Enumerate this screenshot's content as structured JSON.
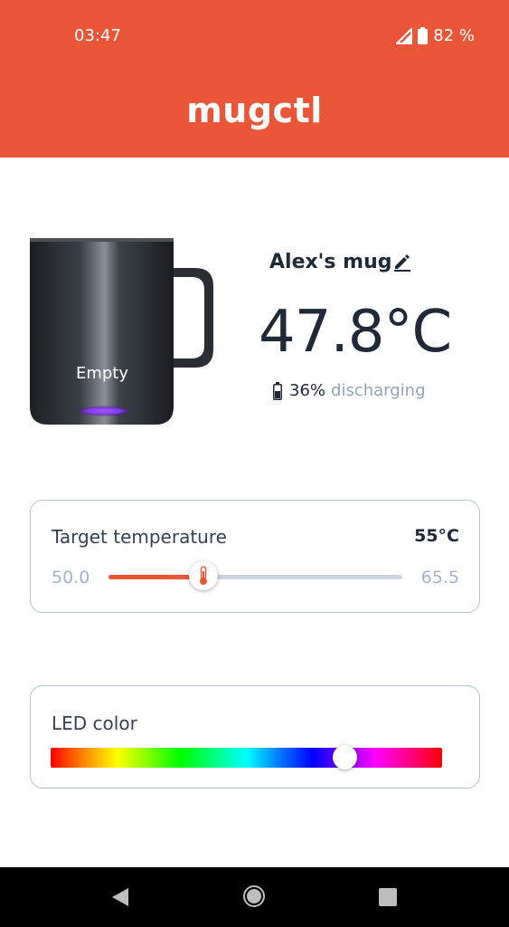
{
  "status_bar": {
    "time": "03:47",
    "battery": "82 %"
  },
  "app_bar": {
    "title": "mugctl"
  },
  "mug": {
    "name": "Alex's mug",
    "liquid_state": "Empty",
    "led_glow_color": "#7c3aed"
  },
  "readout": {
    "temperature": "47.8°C",
    "battery_percent": "36%",
    "battery_state": "discharging"
  },
  "target_temperature": {
    "label": "Target temperature",
    "value_label": "55°C",
    "min_label": "50.0",
    "max_label": "65.5",
    "min": 50.0,
    "max": 65.5,
    "value": 55.0
  },
  "led": {
    "label": "LED color",
    "hue_fraction": 0.75
  },
  "colors": {
    "accent": "#e85637",
    "text": "#1f2937",
    "muted": "#94a3b8"
  },
  "icons": [
    "signal-icon",
    "battery-icon",
    "edit-icon",
    "thermometer-icon",
    "back-icon",
    "home-icon",
    "recents-icon"
  ]
}
